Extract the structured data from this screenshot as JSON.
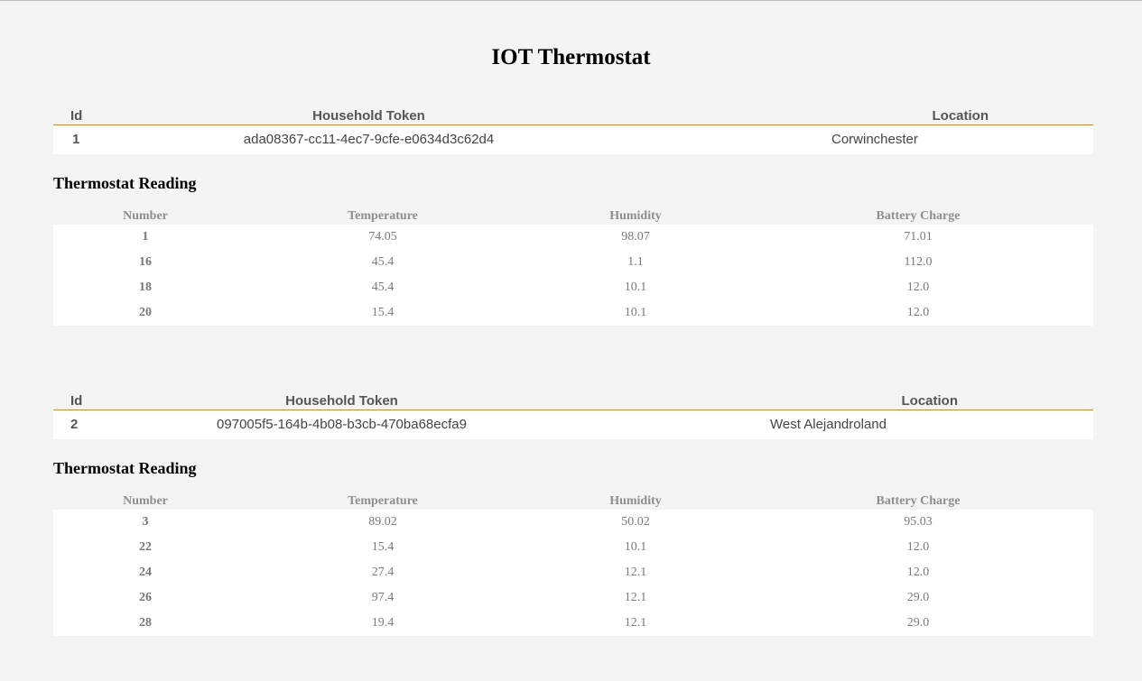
{
  "page": {
    "title": "IOT Thermostat"
  },
  "household_headers": {
    "id": "Id",
    "token": "Household Token",
    "location": "Location"
  },
  "reading_headers": {
    "number": "Number",
    "temperature": "Temperature",
    "humidity": "Humidity",
    "battery": "Battery Charge"
  },
  "reading_section_title": "Thermostat Reading",
  "households": [
    {
      "id": "1",
      "token": "ada08367-cc11-4ec7-9cfe-e0634d3c62d4",
      "location": "Corwinchester",
      "readings": [
        {
          "number": "1",
          "temperature": "74.05",
          "humidity": "98.07",
          "battery": "71.01"
        },
        {
          "number": "16",
          "temperature": "45.4",
          "humidity": "1.1",
          "battery": "112.0"
        },
        {
          "number": "18",
          "temperature": "45.4",
          "humidity": "10.1",
          "battery": "12.0"
        },
        {
          "number": "20",
          "temperature": "15.4",
          "humidity": "10.1",
          "battery": "12.0"
        }
      ]
    },
    {
      "id": "2",
      "token": "097005f5-164b-4b08-b3cb-470ba68ecfa9",
      "location": "West Alejandroland",
      "readings": [
        {
          "number": "3",
          "temperature": "89.02",
          "humidity": "50.02",
          "battery": "95.03"
        },
        {
          "number": "22",
          "temperature": "15.4",
          "humidity": "10.1",
          "battery": "12.0"
        },
        {
          "number": "24",
          "temperature": "27.4",
          "humidity": "12.1",
          "battery": "12.0"
        },
        {
          "number": "26",
          "temperature": "97.4",
          "humidity": "12.1",
          "battery": "29.0"
        },
        {
          "number": "28",
          "temperature": "19.4",
          "humidity": "12.1",
          "battery": "29.0"
        }
      ]
    }
  ]
}
